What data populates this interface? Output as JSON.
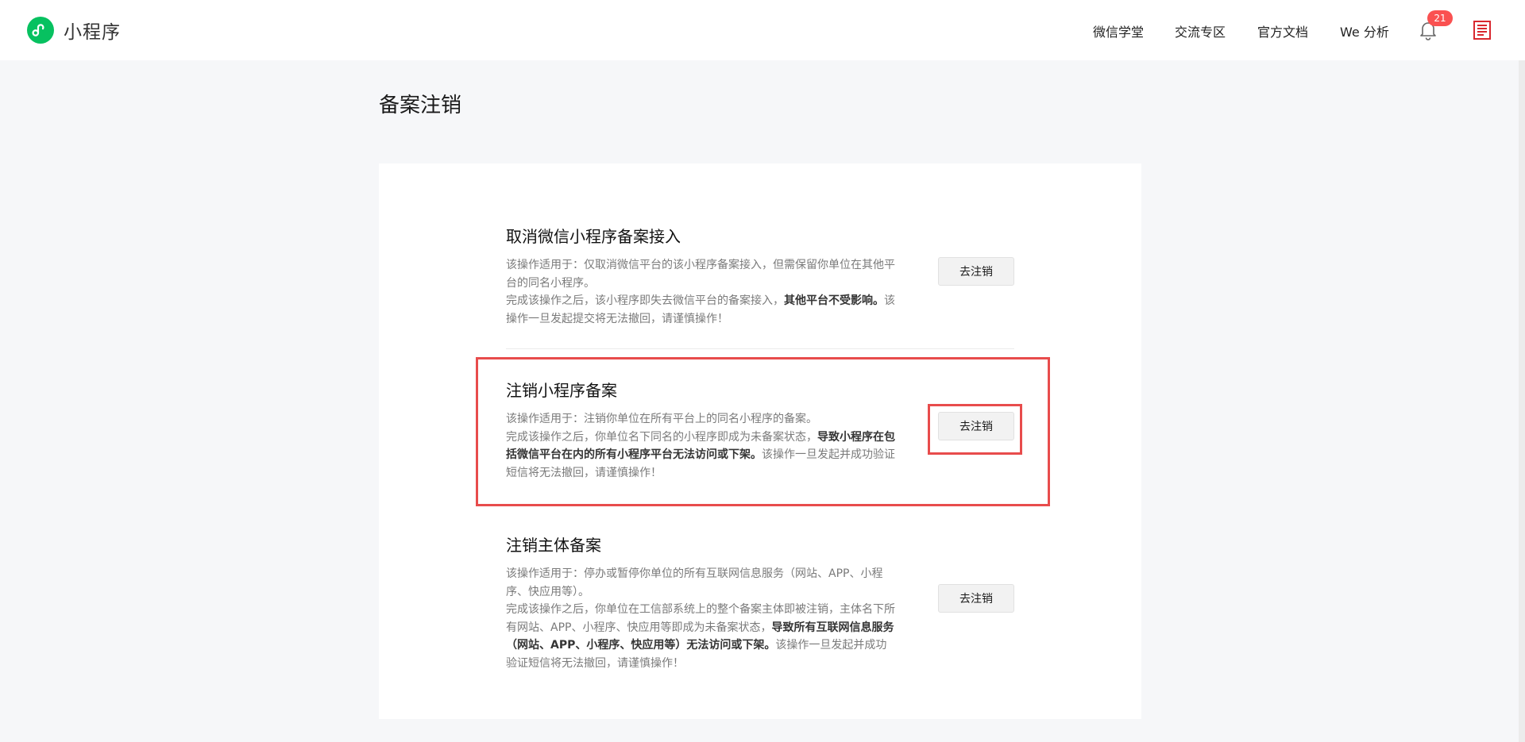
{
  "header": {
    "app_name": "小程序",
    "nav": [
      {
        "label": "微信学堂"
      },
      {
        "label": "交流专区"
      },
      {
        "label": "官方文档"
      },
      {
        "label": "We 分析"
      }
    ],
    "notification_count": "21",
    "icons": {
      "logo": "mini-program-logo-icon",
      "bell": "bell-icon",
      "avatar": "avatar-icon"
    },
    "colors": {
      "brand": "#07c160",
      "badge": "#fa5151",
      "highlight": "#e84c4c"
    }
  },
  "page": {
    "title": "备案注销"
  },
  "sections": [
    {
      "title": "取消微信小程序备案接入",
      "desc_1": "该操作适用于：仅取消微信平台的该小程序备案接入，但需保留你单位在其他平台的同名小程序。",
      "desc_2a": "完成该操作之后，该小程序即失去微信平台的备案接入，",
      "desc_2b": "其他平台不受影响。",
      "desc_2c": "该操作一旦发起提交将无法撤回，请谨慎操作！",
      "button": "去注销"
    },
    {
      "title": "注销小程序备案",
      "desc_1": "该操作适用于：注销你单位在所有平台上的同名小程序的备案。",
      "desc_2a": "完成该操作之后，你单位名下同名的小程序即成为未备案状态，",
      "desc_2b": "导致小程序在包括微信平台在内的所有小程序平台无法访问或下架。",
      "desc_2c": "该操作一旦发起并成功验证短信将无法撤回，请谨慎操作！",
      "button": "去注销"
    },
    {
      "title": "注销主体备案",
      "desc_1": "该操作适用于：停办或暂停你单位的所有互联网信息服务（网站、APP、小程序、快应用等）。",
      "desc_2a": "完成该操作之后，你单位在工信部系统上的整个备案主体即被注销，主体名下所有网站、APP、小程序、快应用等即成为未备案状态，",
      "desc_2b": "导致所有互联网信息服务（网站、APP、小程序、快应用等）无法访问或下架。",
      "desc_2c": "该操作一旦发起并成功验证短信将无法撤回，请谨慎操作！",
      "button": "去注销"
    }
  ]
}
